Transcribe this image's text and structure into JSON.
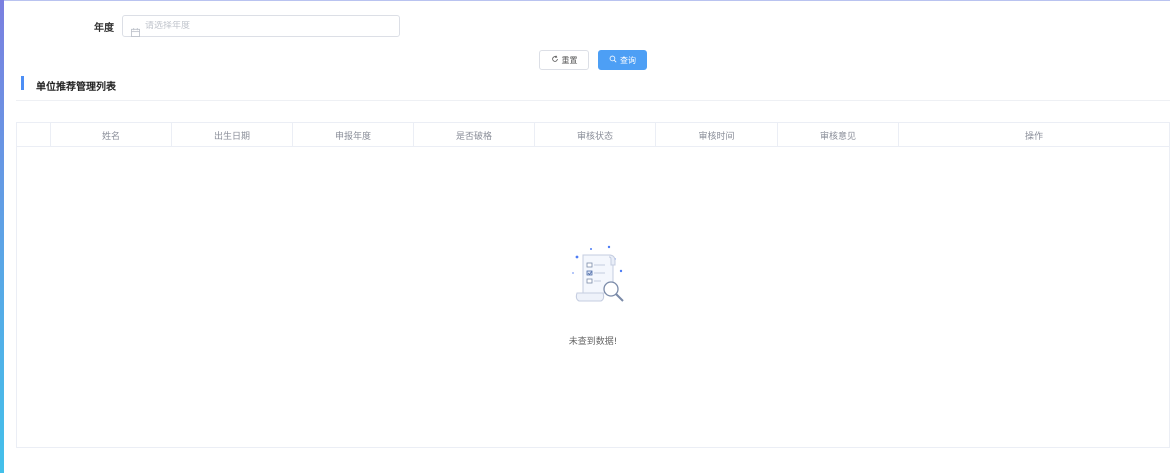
{
  "filter": {
    "year_label": "年度",
    "year_placeholder": "请选择年度"
  },
  "buttons": {
    "reset_label": "重置",
    "search_label": "查询"
  },
  "section": {
    "title": "单位推荐管理列表"
  },
  "table": {
    "columns": [
      "",
      "姓名",
      "出生日期",
      "申报年度",
      "是否破格",
      "审核状态",
      "审核时间",
      "审核意见",
      "操作"
    ],
    "rows": []
  },
  "empty_state": {
    "text": "未查到数据!"
  },
  "colors": {
    "primary": "#4d9ff5",
    "accent_bar": "#4d8ef5",
    "border": "#ebeef5"
  }
}
